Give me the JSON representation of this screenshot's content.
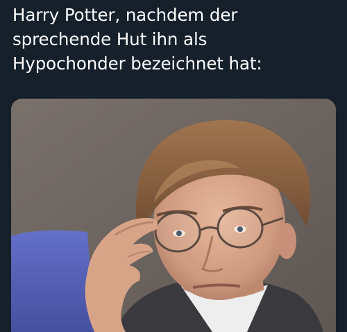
{
  "post": {
    "text_lines": [
      "Harry Potter, nachdem der",
      "sprechende Hut ihn als",
      "Hypochonder bezeichnet hat:"
    ]
  },
  "media": {
    "subject": "photo of a man with round glasses looking over them while touching the frame",
    "icon": "photo-icon"
  },
  "colors": {
    "background": "#15202b",
    "text": "#ffffff",
    "photo_background": "#6e6560",
    "photo_blue_chair": "#5660b5",
    "hair": "#8c6440",
    "skin": "#d9a98e"
  }
}
